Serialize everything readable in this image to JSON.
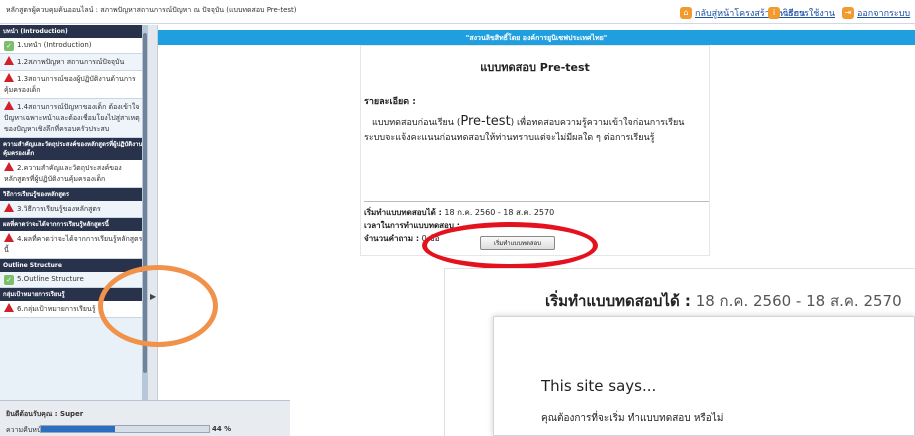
{
  "course_title": "หลักสูตรผู้ควบคุมค้นออนไลน์ : สภาพปัญหาสถานการณ์ปัญหา ณ ปัจจุบัน (แบบทดสอบ Pre-test)",
  "topnav": {
    "home": "กลับสู่หน้าโครงสร้างบทเรียน",
    "howto": "วิธีการใช้งาน",
    "logout": "ออกจากระบบ"
  },
  "sidebar": {
    "sections": [
      {
        "header": "บทนำ (Introduction)",
        "items": [
          {
            "label": "1.บทนำ (Introduction)",
            "status": "done"
          },
          {
            "label": "1.2สภาพปัญหา สถานการณ์ปัจจุบัน",
            "status": "todo"
          },
          {
            "label": "1.3สถานการณ์ของผู้ปฏิบัติงานด้านการคุ้มครองเด็ก",
            "status": "todo"
          },
          {
            "label": "1.4สถานการณ์ปัญหาของเด็ก ต้องเข้าใจปัญหาเฉพาะหน้าและต้องเชื่อมโยงไปสู่สาเหตุของปัญหาเชิงลึกที่ครอบครัวประสบ",
            "status": "todo"
          }
        ]
      },
      {
        "header": "ความสำคัญและวัตถุประสงค์ของหลักสูตรที่ผู้ปฏิบัติงานคุ้มครองเด็ก",
        "items": [
          {
            "label": "2.ความสำคัญและวัตถุประสงค์ของหลักสูตรที่ผู้ปฏิบัติงานคุ้มครองเด็ก",
            "status": "todo"
          }
        ]
      },
      {
        "header": "วิธีการเรียนรู้ของหลักสูตร",
        "items": [
          {
            "label": "3.วิธีการเรียนรู้ของหลักสูตร",
            "status": "todo"
          }
        ]
      },
      {
        "header": "ผลที่คาดว่าจะได้จากการเรียนรู้หลักสูตรนี้",
        "items": [
          {
            "label": "4.ผลที่คาดว่าจะได้จากการเรียนรู้หลักสูตรนี้",
            "status": "todo"
          }
        ]
      },
      {
        "header": "Outline Structure",
        "items": [
          {
            "label": "5.Outline Structure",
            "status": "done"
          }
        ]
      },
      {
        "header": "กลุ่มเป้าหมายการเรียนรู้",
        "items": [
          {
            "label": "6.กลุ่มเป้าหมายการเรียนรู้",
            "status": "todo"
          }
        ]
      }
    ]
  },
  "footer": {
    "welcome": "ยินดีต้อนรับคุณ : Super",
    "progress_label": "ความคืบหน้า",
    "progress_value": "44 %",
    "progress_fraction": 0.44
  },
  "banner": "\"สงวนลิขสิทธิ์โดย องค์การยูนิเซฟประเทศไทย\"",
  "test": {
    "title": "แบบทดสอบ Pre-test",
    "detail_label": "รายละเอียด :",
    "description_pre": "แบบทดสอบก่อนเรียน (",
    "description_emph": "Pre-test",
    "description_post": ") เพื่อทดสอบความรู้ความเข้าใจก่อนการเรียน ระบบจะแจ้งคะแนนก่อนทดสอบให้ท่านทราบแต่จะไม่มีผลใด ๆ ต่อการเรียนรู้",
    "start_label": "เริ่มทำแบบทดสอบได้ :",
    "start_value": "18 ก.ค. 2560 - 18 ส.ค. 2570",
    "time_label": "เวลาในการทำแบบทดสอบ :",
    "time_value": "-",
    "count_label": "จำนวนคำถาม :",
    "count_value": "0 ข้อ",
    "button": "เริ่มทำแบบทดสอบ"
  },
  "zoom": {
    "label": "เริ่มทำแบบทดสอบได้ :",
    "value": "18 ก.ค. 2560 - 18 ส.ค. 2570"
  },
  "dialog": {
    "title": "This site says...",
    "message": "คุณต้องการที่จะเริ่ม ทำแบบทดสอบ หรือไม่"
  },
  "colors": {
    "band": "#1f9fe0",
    "annotation_red": "#e4121f",
    "annotation_orange": "#f0924a",
    "sidebar_header": "#28324a"
  }
}
